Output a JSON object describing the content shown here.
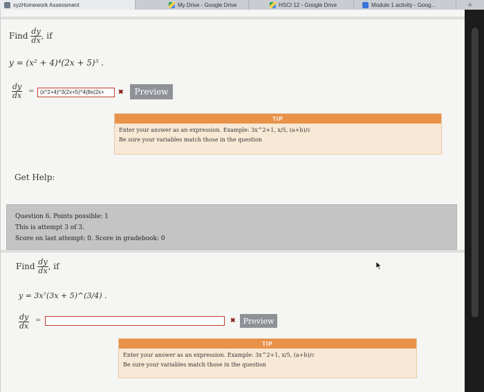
{
  "tabs": [
    {
      "label": "xyzHomework Assessment",
      "icon": "x-icon"
    },
    {
      "label": "My Drive - Google Drive",
      "icon": "google-drive-icon"
    },
    {
      "label": "HSCI 12 - Google Drive",
      "icon": "google-drive-icon"
    },
    {
      "label": "Module 1 activity - Goog...",
      "icon": "google-forms-icon"
    }
  ],
  "new_tab": "+",
  "q5": {
    "find": "Find",
    "if": ", if",
    "frac_num": "dy",
    "frac_den": "dx",
    "equation": "y = (x² + 4)⁴(2x + 5)⁵ .",
    "equals": "=",
    "answer_value": "(x^2+4)^3(2x+5)^4(8x(2x+",
    "wrong_mark": "✖",
    "preview_label": "Preview",
    "tip_title": "TIP",
    "tip_line1": "Enter your answer as an expression. Example: 3x^2+1, x/5, (a+b)/c",
    "tip_line2": "Be sure your variables match those in the question"
  },
  "get_help": "Get Help:",
  "q6_info": {
    "line1": "Question 6. Points possible: 1",
    "line2": "This is attempt 3 of 3.",
    "line3": "Score on last attempt: 0. Score in gradebook: 0"
  },
  "q6": {
    "find": "Find",
    "if": ", if",
    "frac_num": "dy",
    "frac_den": "dx",
    "equation": "y = 3x⁷(3x + 5)^(3/4) .",
    "equals": "=",
    "answer_value": "",
    "wrong_mark": "✖",
    "preview_label": "Preview",
    "tip_title": "TIP",
    "tip_line1": "Enter your answer as an expression. Example: 3x^2+1, x/5, (a+b)/c",
    "tip_line2": "Be sure your variables match those in the question"
  },
  "colors": {
    "tip_header": "#e8924a",
    "tip_body": "#f8e9d6",
    "error_border": "#c0392b",
    "preview_button": "#8e9196"
  }
}
